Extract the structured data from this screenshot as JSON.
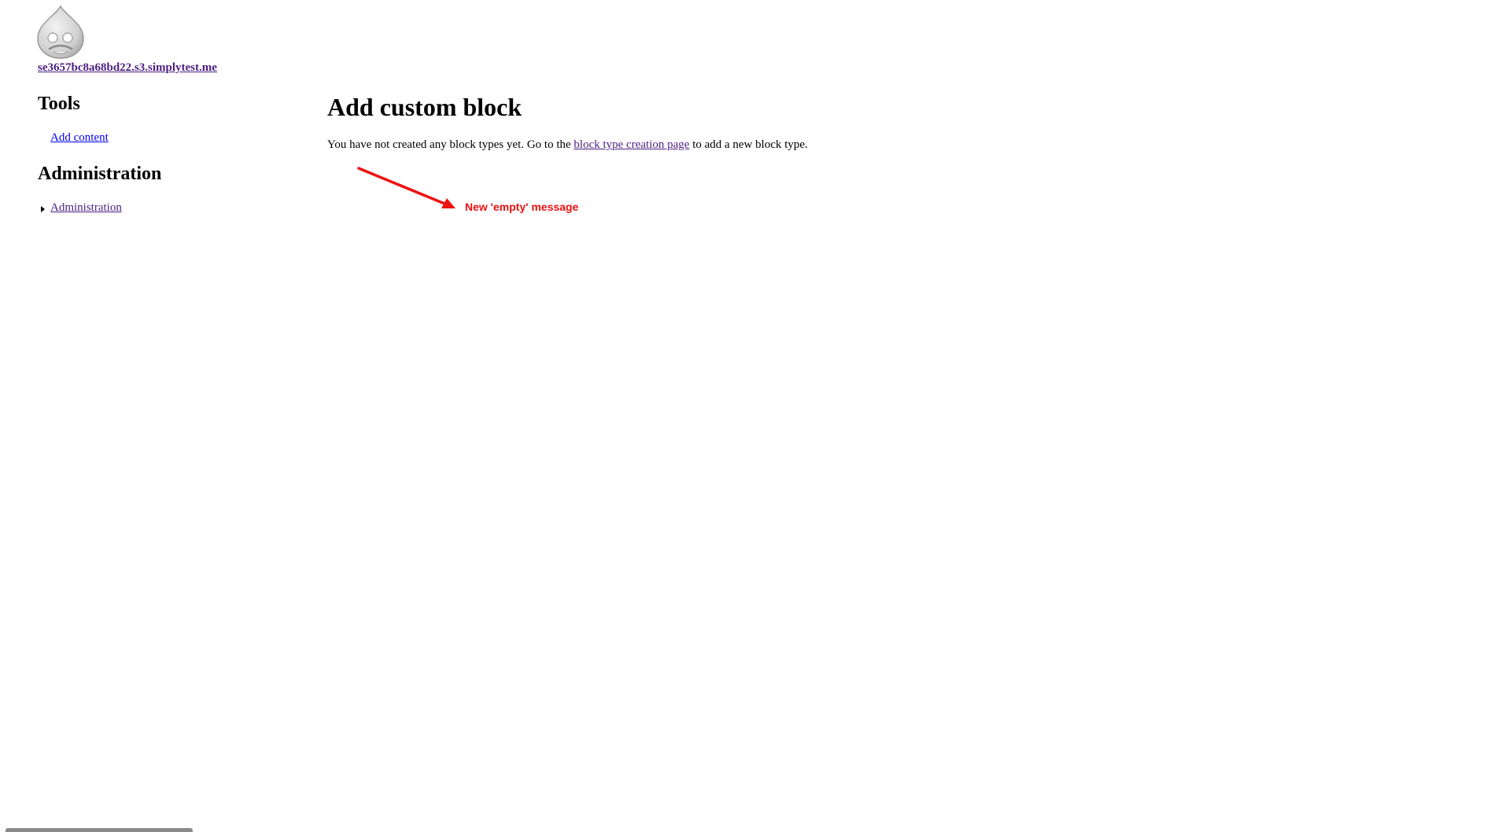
{
  "site": {
    "name": "se3657bc8a68bd22.s3.simplytest.me",
    "logo_icon": "drupal-drop-icon"
  },
  "sidebar": {
    "tools": {
      "title": "Tools",
      "items": [
        {
          "label": "Add content"
        }
      ]
    },
    "administration": {
      "title": "Administration",
      "items": [
        {
          "label": "Administration",
          "icon": "collapsed-arrow-icon"
        }
      ]
    }
  },
  "main": {
    "title": "Add custom block",
    "empty_message": {
      "before": "You have not created any block types yet. Go to the ",
      "link": "block type creation page",
      "after": " to add a new block type."
    }
  },
  "annotation": {
    "label": "New 'empty' message",
    "color": "#ee1111"
  },
  "colors": {
    "visited_link": "#4b1e82",
    "link": "#0000ee"
  }
}
